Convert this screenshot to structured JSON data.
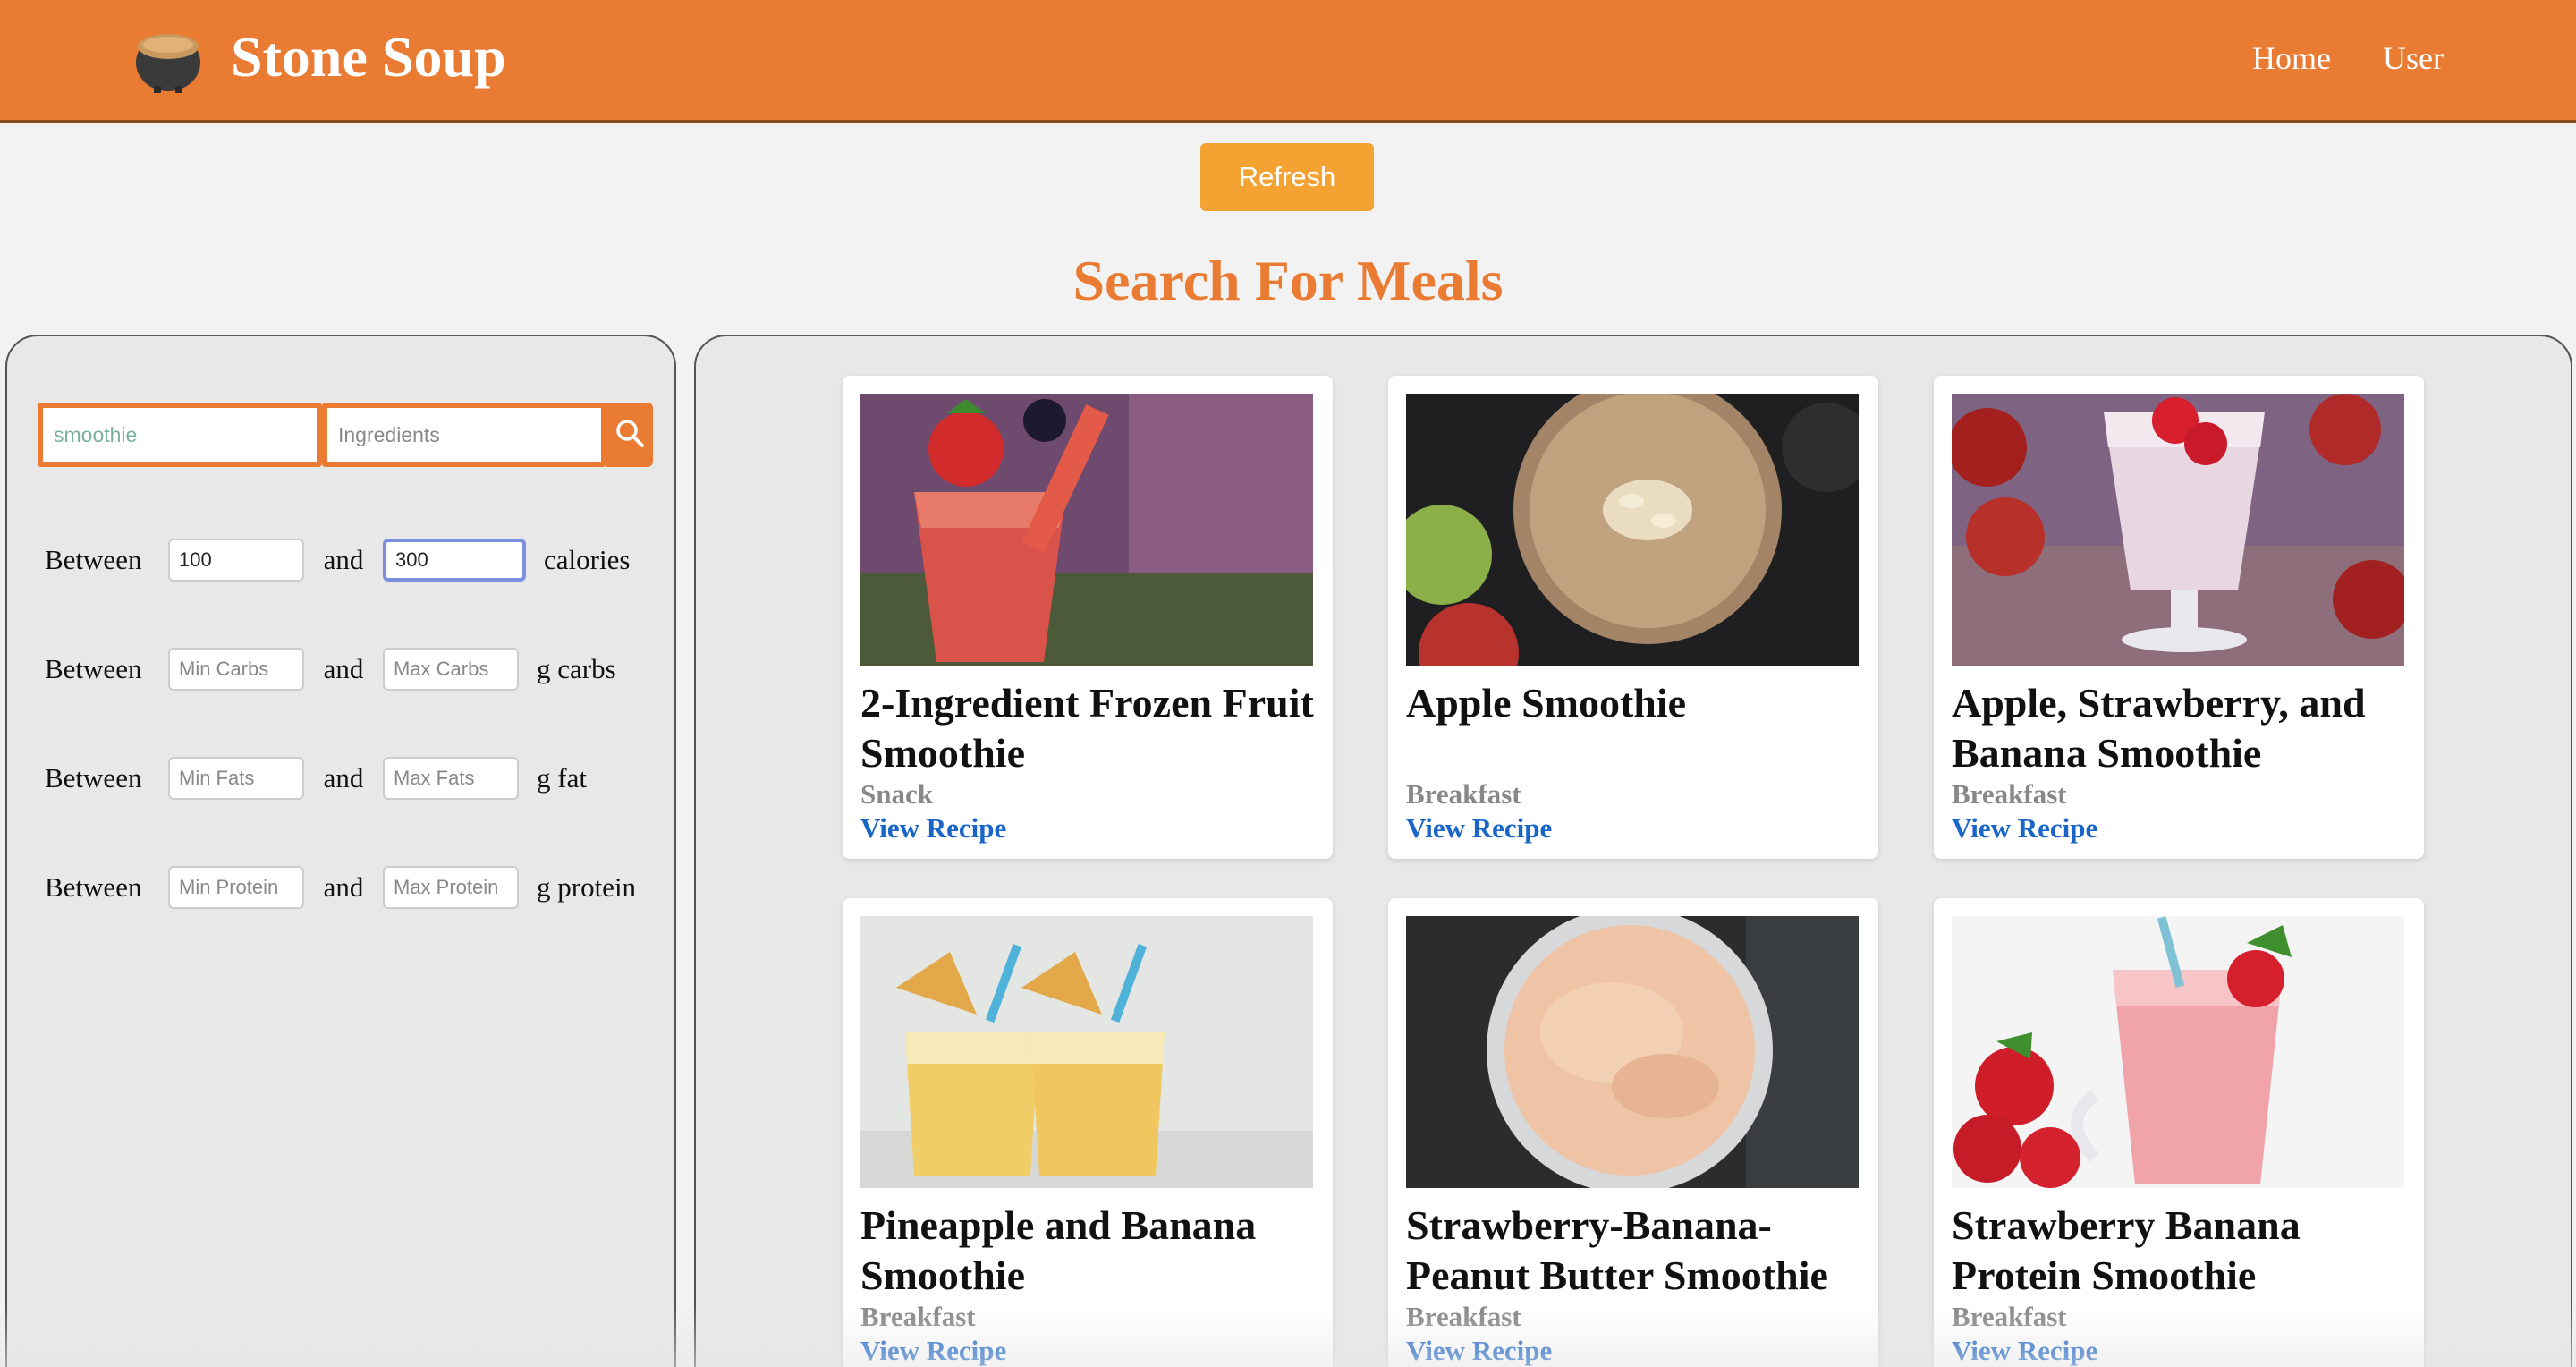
{
  "header": {
    "brand": "Stone Soup",
    "logo_icon": "soup-pot-icon",
    "nav": [
      {
        "label": "Home"
      },
      {
        "label": "User"
      }
    ],
    "color": "#e97b33"
  },
  "refresh_label": "Refresh",
  "page_title": "Search For Meals",
  "filters": {
    "search": {
      "name_value": "",
      "name_placeholder": "smoothie",
      "ingredients_value": "",
      "ingredients_placeholder": "Ingredients",
      "search_icon": "search-icon"
    },
    "ranges": [
      {
        "label": "Between",
        "and": "and",
        "unit": "calories",
        "min_value": "100",
        "min_placeholder": "",
        "max_value": "300",
        "max_placeholder": ""
      },
      {
        "label": "Between",
        "and": "and",
        "unit": "g carbs",
        "min_value": "",
        "min_placeholder": "Min Carbs",
        "max_value": "",
        "max_placeholder": "Max Carbs"
      },
      {
        "label": "Between",
        "and": "and",
        "unit": "g fat",
        "min_value": "",
        "min_placeholder": "Min Fats",
        "max_value": "",
        "max_placeholder": "Max Fats"
      },
      {
        "label": "Between",
        "and": "and",
        "unit": "g protein",
        "min_value": "",
        "min_placeholder": "Min Protein",
        "max_value": "",
        "max_placeholder": "Max Protein"
      }
    ]
  },
  "results": [
    {
      "title": "2-Ingredient Frozen Fruit Smoothie",
      "category": "Snack",
      "link": "View Recipe"
    },
    {
      "title": "Apple Smoothie",
      "category": "Breakfast",
      "link": "View Recipe"
    },
    {
      "title": "Apple, Strawberry, and Banana Smoothie",
      "category": "Breakfast",
      "link": "View Recipe"
    },
    {
      "title": "Pineapple and Banana Smoothie",
      "category": "Breakfast",
      "link": "View Recipe"
    },
    {
      "title": "Strawberry-Banana-Peanut Butter Smoothie",
      "category": "Breakfast",
      "link": "View Recipe"
    },
    {
      "title": "Strawberry Banana Protein Smoothie",
      "category": "Breakfast",
      "link": "View Recipe"
    }
  ]
}
